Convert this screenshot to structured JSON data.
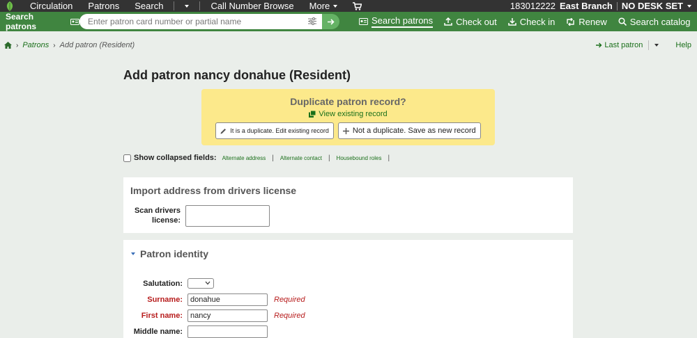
{
  "nav": {
    "items": [
      "Circulation",
      "Patrons",
      "Search",
      "Call Number Browse",
      "More"
    ],
    "branch_code": "183012222",
    "branch_name": "East Branch",
    "desk": "NO DESK SET"
  },
  "searchbar": {
    "label": "Search patrons",
    "placeholder": "Enter patron card number or partial name",
    "tools": [
      "Search patrons",
      "Check out",
      "Check in",
      "Renew",
      "Search catalog"
    ]
  },
  "breadcrumb": {
    "patrons": "Patrons",
    "current": "Add patron (Resident)"
  },
  "header_actions": {
    "last_patron": "Last patron",
    "help": "Help"
  },
  "page_title": "Add patron nancy donahue (Resident)",
  "duplicate": {
    "title": "Duplicate patron record?",
    "view_link": "View existing record",
    "is_duplicate_button": "It is a duplicate. Edit existing record",
    "not_duplicate_button": "Not a duplicate. Save as new record"
  },
  "collapsed": {
    "label": "Show collapsed fields:",
    "links": [
      "Alternate address",
      "Alternate contact",
      "Housebound roles"
    ]
  },
  "import_panel": {
    "title": "Import address from drivers license",
    "scan_label": "Scan drivers license:"
  },
  "identity_panel": {
    "title": "Patron identity",
    "salutation_label": "Salutation:",
    "salutation_value": "",
    "surname_label": "Surname:",
    "surname_value": "donahue",
    "firstname_label": "First name:",
    "firstname_value": "nancy",
    "middlename_label": "Middle name:",
    "middlename_value": "",
    "required_text": "Required"
  },
  "colors": {
    "topnav": "#333333",
    "searchbar": "#408540",
    "link_green": "#1a6f1a",
    "duplicate_bg": "#fce98b",
    "required_red": "#b71c1c"
  }
}
